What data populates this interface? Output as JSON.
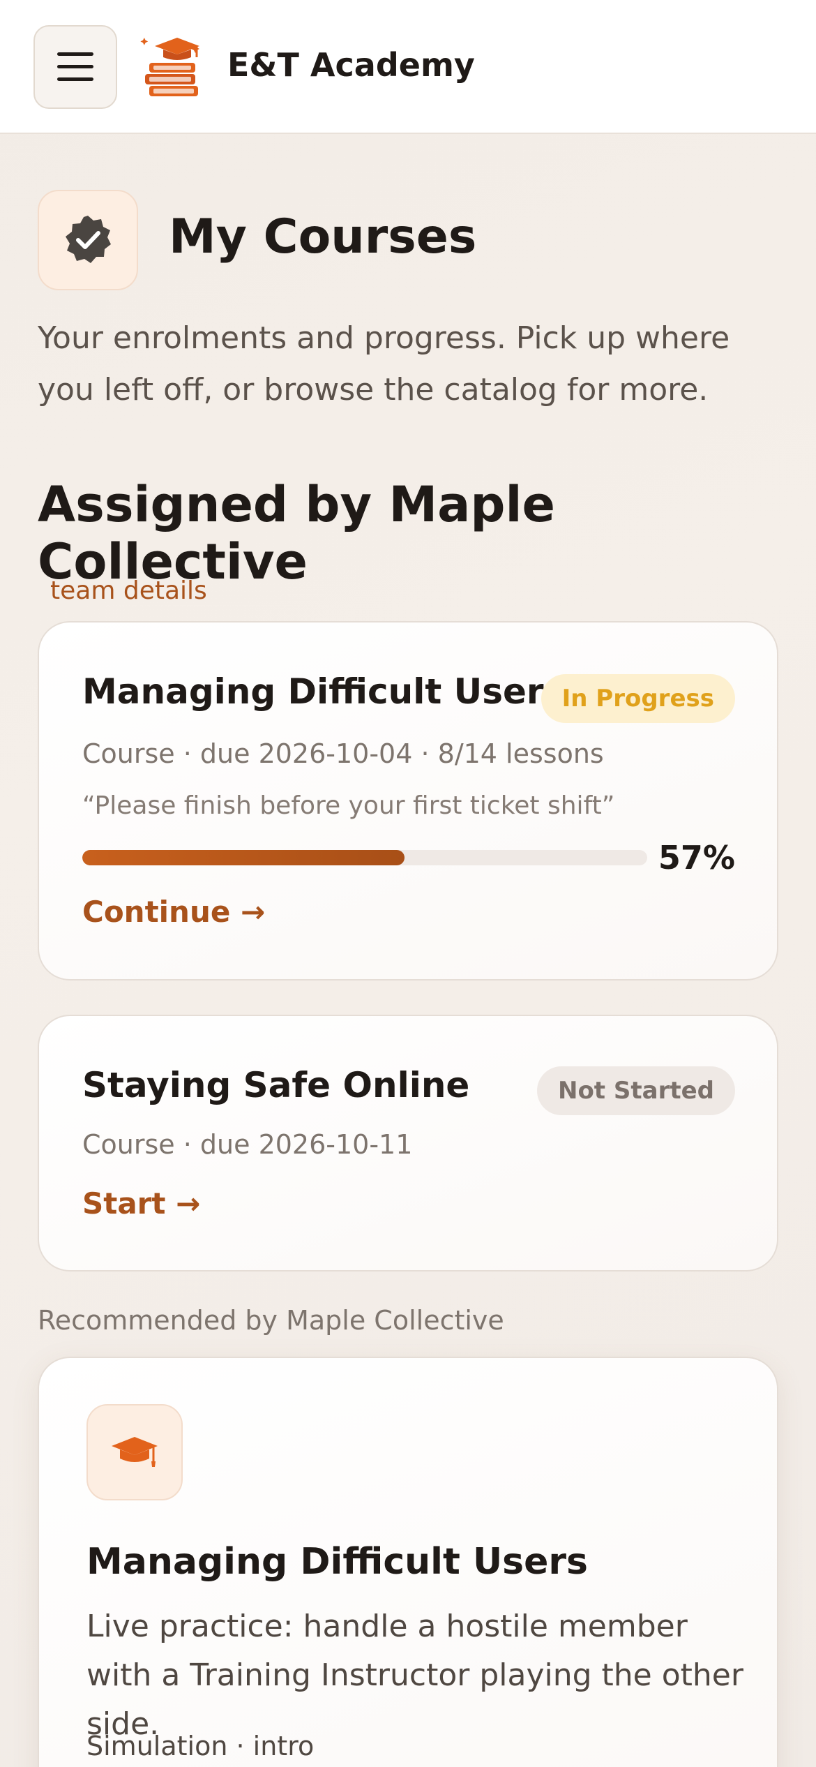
{
  "header": {
    "menu_icon": "hamburger-menu-icon",
    "logo_icon": "books-graduation-cap-logo",
    "brand": "E&T Academy",
    "accent": "#e2621b"
  },
  "intro": {
    "icon": "verified-badge-icon",
    "title": "My Courses",
    "subtitle": "Your enrolments and progress. Pick up where you left off, or browse the catalog for more."
  },
  "assigned": {
    "section_title": "Assigned by Maple Collective",
    "team_link": "team details",
    "courses": [
      {
        "title": "Managing Difficult Users",
        "status": "In Progress",
        "meta": "Course · due 2026-10-04 · 8/14 lessons",
        "note": "“Please finish before your first ticket shift”",
        "progress_fraction": 0.57,
        "progress_label": "57%",
        "action": "Continue →"
      },
      {
        "title": "Staying Safe Online",
        "status": "Not Started",
        "meta": "Course · due 2026-10-11",
        "action": "Start →"
      }
    ]
  },
  "recommended": {
    "label": "Recommended by Maple Collective",
    "items": [
      {
        "icon": "graduation-cap-icon",
        "title": "Managing Difficult Users",
        "description": "Live practice: handle a hostile member with a Training Instructor playing the other side.",
        "meta": "Simulation · intro"
      }
    ]
  }
}
